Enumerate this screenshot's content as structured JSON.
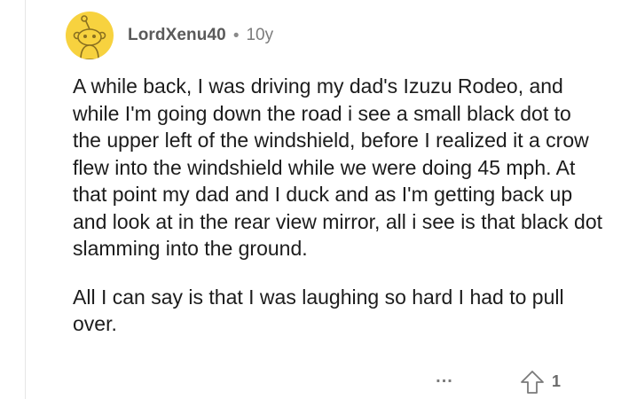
{
  "comment": {
    "author": "LordXenu40",
    "separator": "•",
    "age": "10y",
    "paragraphs": [
      "A while back, I was driving my dad's Izuzu Rodeo, and while I'm going down the road i see a small black dot to the upper left of the windshield, before I realized it a crow flew into the windshield while we were doing 45 mph. At that point my dad and I duck and as I'm getting back up and look at in the rear view mirror, all i see is that black dot slamming into the ground.",
      "All I can say is that I was laughing so hard I had to pull over."
    ],
    "actions": {
      "more_label": "...",
      "upvote_icon": "upvote-arrow-icon",
      "vote_count": "1"
    }
  },
  "colors": {
    "avatar_background": "#f7d23f",
    "text": "#1c1c1c",
    "meta": "#5a5a5a"
  }
}
